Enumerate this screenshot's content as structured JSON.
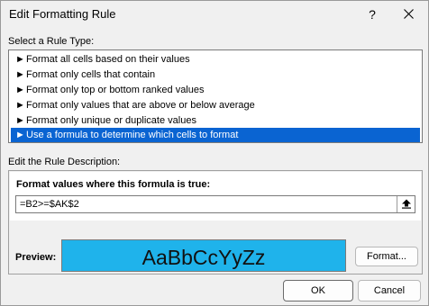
{
  "window": {
    "title": "Edit Formatting Rule",
    "help_label": "?"
  },
  "rule_type": {
    "label": "Select a Rule Type:",
    "items": [
      {
        "label": "Format all cells based on their values"
      },
      {
        "label": "Format only cells that contain"
      },
      {
        "label": "Format only top or bottom ranked values"
      },
      {
        "label": "Format only values that are above or below average"
      },
      {
        "label": "Format only unique or duplicate values"
      },
      {
        "label": "Use a formula to determine which cells to format",
        "selected": true
      }
    ],
    "item_glyph": "►"
  },
  "description": {
    "label": "Edit the Rule Description:",
    "formula_label": "Format values where this formula is true:",
    "formula_value": "=B2>=$AK$2",
    "preview_label": "Preview:",
    "preview_text": "AaBbCcYyZz",
    "preview_color": "#1fb3eb",
    "format_button": "Format..."
  },
  "buttons": {
    "ok": "OK",
    "cancel": "Cancel"
  },
  "colors": {
    "selection": "#0a64d2",
    "dialog_bg": "#f0f0f0"
  }
}
